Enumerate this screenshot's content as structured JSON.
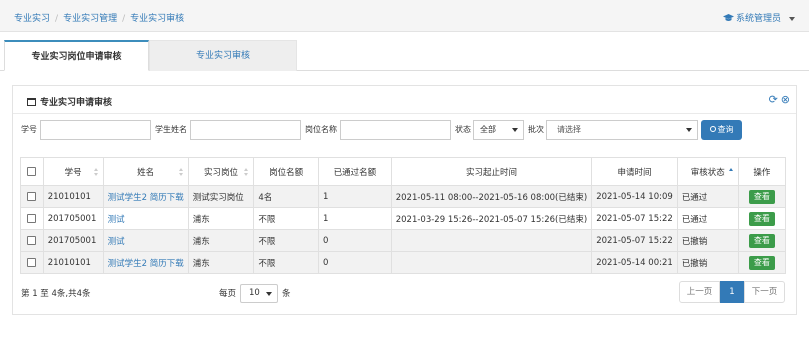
{
  "breadcrumb": [
    "专业实习",
    "专业实习管理",
    "专业实习审核"
  ],
  "user": {
    "label": "系统管理员"
  },
  "tabs": [
    {
      "label": "专业实习岗位申请审核",
      "active": true
    },
    {
      "label": "专业实习审核",
      "active": false
    }
  ],
  "panel": {
    "title": "专业实习申请审核"
  },
  "filters": {
    "student_no_label": "学号",
    "student_name_label": "学生姓名",
    "position_name_label": "岗位名称",
    "status_label": "状态",
    "status_value": "全部",
    "batch_label": "批次",
    "batch_placeholder": "请选择",
    "query_label": "查询"
  },
  "table": {
    "headers": [
      "学号",
      "姓名",
      "实习岗位",
      "岗位名额",
      "已通过名额",
      "实习起止时间",
      "申请时间",
      "审核状态",
      "操作"
    ],
    "rows": [
      {
        "no": "21010101",
        "name": "测试学生2",
        "resume": "简历下载",
        "position": "测试实习岗位",
        "quota": "4名",
        "passed": "1",
        "period": "2021-05-11 08:00--2021-05-16 08:00(已结束)",
        "applied": "2021-05-14 10:09",
        "status": "已通过",
        "action": "查看"
      },
      {
        "no": "201705001",
        "name": "测试",
        "resume": "",
        "position": "浦东",
        "quota": "不限",
        "passed": "1",
        "period": "2021-03-29 15:26--2021-05-07 15:26(已结束)",
        "applied": "2021-05-07 15:22",
        "status": "已通过",
        "action": "查看"
      },
      {
        "no": "201705001",
        "name": "测试",
        "resume": "",
        "position": "浦东",
        "quota": "不限",
        "passed": "0",
        "period": "",
        "applied": "2021-05-07 15:22",
        "status": "已撤销",
        "action": "查看"
      },
      {
        "no": "21010101",
        "name": "测试学生2",
        "resume": "简历下载",
        "position": "浦东",
        "quota": "不限",
        "passed": "0",
        "period": "",
        "applied": "2021-05-14 00:21",
        "status": "已撤销",
        "action": "查看"
      }
    ]
  },
  "footer": {
    "info": "第 1 至 4条,共4条",
    "per_page_label": "每页",
    "per_page_value": "10",
    "per_page_unit": "条",
    "prev_label": "上一页",
    "current_page": "1",
    "next_label": "下一页"
  },
  "colors": {
    "primary": "#337ab7",
    "success": "#3c9c4a"
  }
}
